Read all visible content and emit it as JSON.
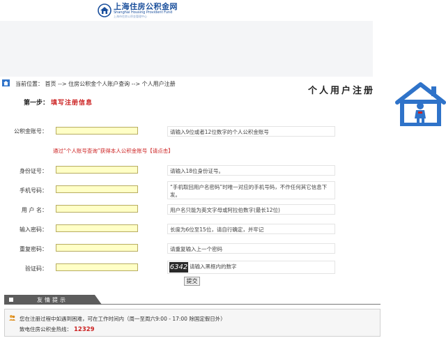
{
  "header": {
    "logo_cn": "上海住房公积金网",
    "logo_en": "Shanghai Housing Provident Fund",
    "logo_sub": "上海市住房公积金管理中心"
  },
  "breadcrumb": "当前位置： 首页 --> 住房公积金个人账户查询 --> 个人用户注册",
  "page_title": "个人用户注册",
  "step": {
    "number": "第一步：",
    "text": "填写注册信息"
  },
  "fields": [
    {
      "label": "公积金账号：",
      "value": "",
      "hint": "请输入9位或者12位数字的个人公积金账号"
    },
    {
      "label": "身份证号：",
      "value": "",
      "hint": "请输入18位身份证号。"
    },
    {
      "label": "手机号码：",
      "value": "",
      "hint": "“手机取回用户名密码”时唯一对应的手机号码，不作任何其它信息下发。"
    },
    {
      "label": "用 户 名：",
      "value": "",
      "hint": "用户名只能为英文字母或阿拉伯数字(最长12位)"
    },
    {
      "label": "输入密码：",
      "value": "",
      "hint": "长度为6位至15位，请自行确定，并牢记"
    },
    {
      "label": "重复密码：",
      "value": "",
      "hint": "请重复输入上一个密码"
    },
    {
      "label": "验证码：",
      "value": "",
      "hint": ""
    }
  ],
  "account_tip": "通过“个人账号查询”获得本人公积金账号【请点击】",
  "captcha": {
    "image_text": "6342",
    "hint": "请输入黑框内的数字"
  },
  "submit_label": "提交",
  "notice": {
    "title": "友情提示",
    "text": "您在注册过程中如遇到困难，可在工作时间内（周一至周六9:00 - 17:00 除国定假日外）",
    "hotline_label": "致电住房公积金热线：",
    "hotline_number": "12329"
  },
  "colors": {
    "brand_blue": "#1a4f9c",
    "house_blue": "#2f73c9",
    "accent_red": "#cc2222",
    "input_bg": "#ffffc6"
  }
}
